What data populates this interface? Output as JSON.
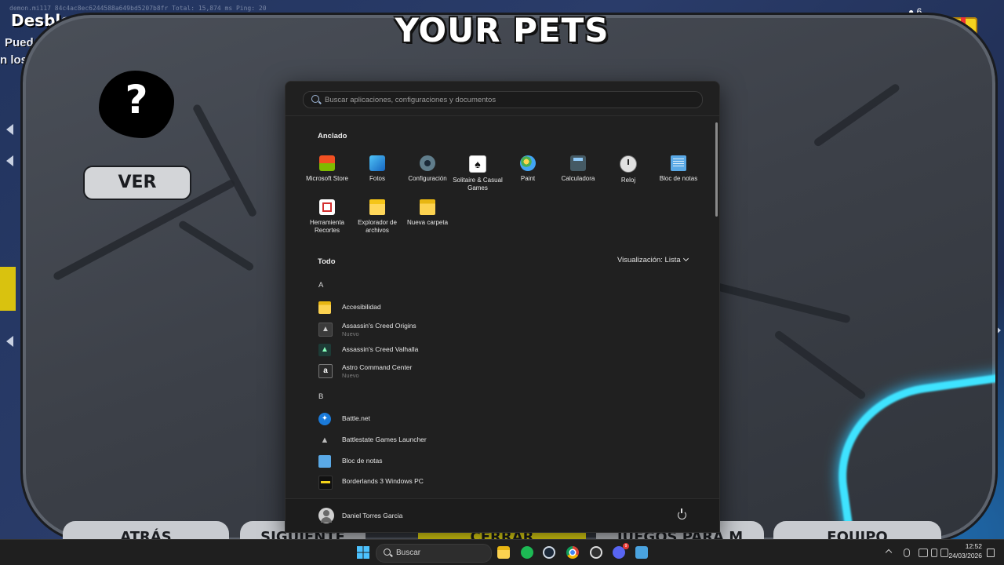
{
  "game": {
    "title": "YOUR PETS",
    "unlock_heading": "Desbloque",
    "hint_line1": "Puedes",
    "hint_line2": "n los",
    "top_overlay": "demon.mi117    84c4ac8ec6244588a649bd5207b8fr          Total: 15,874 ms              Ping: 20",
    "players_count": "6",
    "view_button": "VER",
    "pet_placeholder": "?",
    "bottom_buttons": {
      "back": "ATRÁS",
      "next": "SIGUIENTE",
      "close": "CERRAR",
      "games": "JUEGOS PARA M",
      "team": "EQUIPO"
    }
  },
  "start_menu": {
    "search": {
      "placeholder": "Buscar aplicaciones, configuraciones y documentos",
      "value": ""
    },
    "pinned_heading": "Anclado",
    "pinned": [
      {
        "label": "Microsoft Store",
        "icon": "store-icon"
      },
      {
        "label": "Fotos",
        "icon": "photos-icon"
      },
      {
        "label": "Configuración",
        "icon": "gear-icon"
      },
      {
        "label": "Solitaire & Casual Games",
        "icon": "cards-icon"
      },
      {
        "label": "Paint",
        "icon": "palette-icon"
      },
      {
        "label": "Calculadora",
        "icon": "calculator-icon"
      },
      {
        "label": "Reloj",
        "icon": "clock-icon"
      },
      {
        "label": "Bloc de notas",
        "icon": "notepad-icon"
      },
      {
        "label": "Herramienta Recortes",
        "icon": "snipping-icon"
      },
      {
        "label": "Explorador de archivos",
        "icon": "folder-icon"
      },
      {
        "label": "Nueva carpeta",
        "icon": "folder-icon"
      }
    ],
    "all_heading": "Todo",
    "view_label": "Visualización: Lista",
    "groups": [
      {
        "letter": "A",
        "items": [
          {
            "label": "Accesibilidad",
            "sub": ""
          },
          {
            "label": "Assassin's Creed Origins",
            "sub": "Nuevo"
          },
          {
            "label": "Assassin's Creed Valhalla",
            "sub": ""
          },
          {
            "label": "Astro Command Center",
            "sub": "Nuevo"
          }
        ]
      },
      {
        "letter": "B",
        "items": [
          {
            "label": "Battle.net",
            "sub": ""
          },
          {
            "label": "Battlestate Games Launcher",
            "sub": ""
          },
          {
            "label": "Bloc de notas",
            "sub": ""
          },
          {
            "label": "Borderlands 3 Windows PC",
            "sub": ""
          }
        ]
      }
    ],
    "user_name": "Daniel Torres Garcia"
  },
  "taskbar": {
    "search_label": "Buscar",
    "time": "12:52",
    "date": "24/03/2026",
    "discord_badge": "9"
  },
  "colors": {
    "accent": "#4cc2ff",
    "menu_bg": "#202020",
    "taskbar_bg": "#1f1f1f",
    "close_button": "#f2e514",
    "glow": "#3fe3ff"
  }
}
